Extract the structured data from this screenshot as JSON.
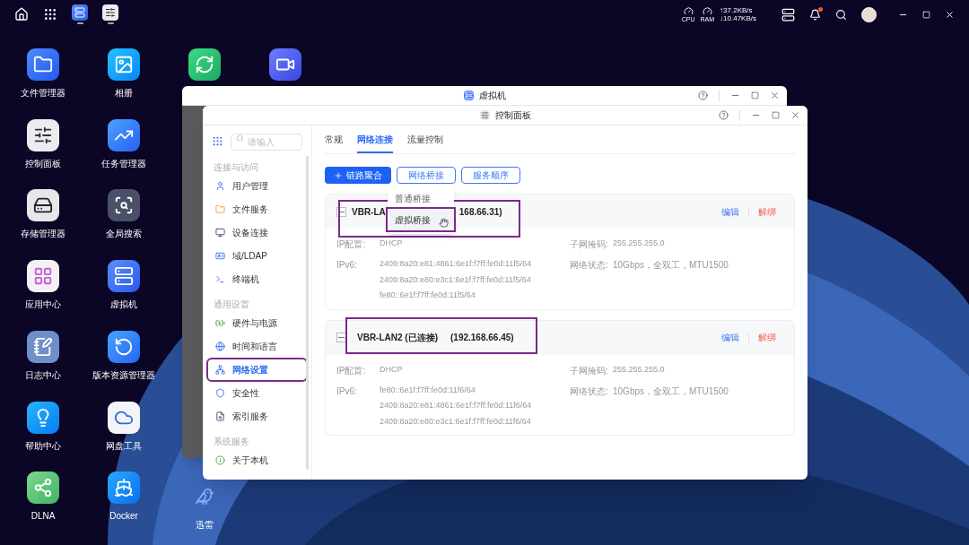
{
  "topbar": {
    "taskbar_apps": [
      {
        "kind": "vm",
        "running": true
      },
      {
        "kind": "control",
        "running": true
      }
    ],
    "monitor": {
      "cpu_label": "CPU",
      "ram_label": "RAM",
      "upload": "↑37.2KB/s",
      "download": "↓10.47KB/s"
    },
    "notifications": {
      "unread": true
    }
  },
  "desktop_columns": [
    {
      "icons": [
        {
          "kind": "files",
          "label": "文件管理器"
        },
        {
          "kind": "control",
          "label": "控制面板"
        },
        {
          "kind": "storage",
          "label": "存储管理器"
        },
        {
          "kind": "appcenter",
          "label": "应用中心"
        },
        {
          "kind": "logs",
          "label": "日志中心"
        },
        {
          "kind": "help",
          "label": "帮助中心"
        },
        {
          "kind": "dlna",
          "label": "DLNA"
        }
      ]
    },
    {
      "icons": [
        {
          "kind": "photos",
          "label": "相册"
        },
        {
          "kind": "tasks",
          "label": "任务管理器"
        },
        {
          "kind": "search",
          "label": "全局搜索"
        },
        {
          "kind": "vm",
          "label": "虚拟机"
        },
        {
          "kind": "versions",
          "label": "版本资源管理器"
        },
        {
          "kind": "netdisk",
          "label": "网盘工具"
        },
        {
          "kind": "docker",
          "label": "Docker"
        }
      ]
    },
    {
      "icons": [
        {
          "kind": "sync"
        },
        {
          "kind": "thunder",
          "label": "迅雷"
        }
      ]
    },
    {
      "icons": [
        {
          "kind": "video"
        }
      ]
    }
  ],
  "back_window": {
    "title": "虚拟机"
  },
  "control_panel": {
    "title": "控制面板",
    "sidebar": {
      "search_placeholder": "请输入",
      "sections": [
        {
          "heading": "连接与访问",
          "items": [
            {
              "kind": "user",
              "label": "用户管理",
              "selected": false,
              "annotated": false
            },
            {
              "kind": "folder",
              "label": "文件服务",
              "selected": false,
              "annotated": false
            },
            {
              "kind": "device",
              "label": "设备连接",
              "selected": false,
              "annotated": false
            },
            {
              "kind": "domain",
              "label": "域/LDAP",
              "selected": false,
              "annotated": false
            },
            {
              "kind": "terminal",
              "label": "终端机",
              "selected": false,
              "annotated": false
            }
          ]
        },
        {
          "heading": "通用设置",
          "items": [
            {
              "kind": "power",
              "label": "硬件与电源",
              "selected": false,
              "annotated": false
            },
            {
              "kind": "time",
              "label": "时间和语言",
              "selected": false,
              "annotated": false
            },
            {
              "kind": "network",
              "label": "网络设置",
              "selected": true,
              "annotated": true
            },
            {
              "kind": "security",
              "label": "安全性",
              "selected": false,
              "annotated": false
            },
            {
              "kind": "index",
              "label": "索引服务",
              "selected": false,
              "annotated": false
            }
          ]
        },
        {
          "heading": "系统服务",
          "items": [
            {
              "kind": "about",
              "label": "关于本机",
              "selected": false,
              "annotated": false
            }
          ]
        }
      ]
    },
    "tabs": [
      {
        "label": "常规",
        "selected": false
      },
      {
        "label": "网络连接",
        "selected": true
      },
      {
        "label": "流量控制",
        "selected": false
      }
    ],
    "toolbar": [
      {
        "kind": "primary",
        "label": "链路聚合"
      },
      {
        "kind": "outline",
        "label": "网络桥接"
      },
      {
        "kind": "outline",
        "label": "服务顺序"
      }
    ],
    "bridge_menu": {
      "items": [
        {
          "label": "普通桥接",
          "hovered": false,
          "annotated": false
        },
        {
          "label": "虚拟桥接",
          "hovered": true,
          "annotated": true
        }
      ]
    },
    "cards": [
      {
        "name": "VBR-LA",
        "ip": "168.66.31)",
        "annotated": true,
        "edit": "编辑",
        "unbind": "解绑",
        "ip_config_label": "IP配置:",
        "ip_config": "DHCP",
        "subnet_label": "子网掩码:",
        "subnet": "255.255.255.0",
        "ipv6_label": "IPv6:",
        "ipv6": [
          "2409:8a20:e81:4861:6e1f:f7ff:fe0d:11f5/64",
          "2409:8a20:e80:e3c1:6e1f:f7ff:fe0d:11f5/64",
          "fe80::6e1f:f7ff:fe0d:11f5/64"
        ],
        "status_label": "网络状态:",
        "status": "10Gbps，全双工，MTU1500"
      },
      {
        "name": "VBR-LAN2 (已连接)",
        "ip": "(192.168.66.45)",
        "annotated": true,
        "edit": "编辑",
        "unbind": "解绑",
        "ip_config_label": "IP配置:",
        "ip_config": "DHCP",
        "subnet_label": "子网掩码:",
        "subnet": "255.255.255.0",
        "ipv6_label": "IPv6:",
        "ipv6": [
          "fe80::6e1f:f7ff:fe0d:11f6/64",
          "2409:8a20:e81:4861:6e1f:f7ff:fe0d:11f6/64",
          "2409:8a20:e80:e3c1:6e1f:f7ff:fe0d:11f6/64"
        ],
        "status_label": "网络状态:",
        "status": "10Gbps，全双工，MTU1500"
      }
    ]
  }
}
